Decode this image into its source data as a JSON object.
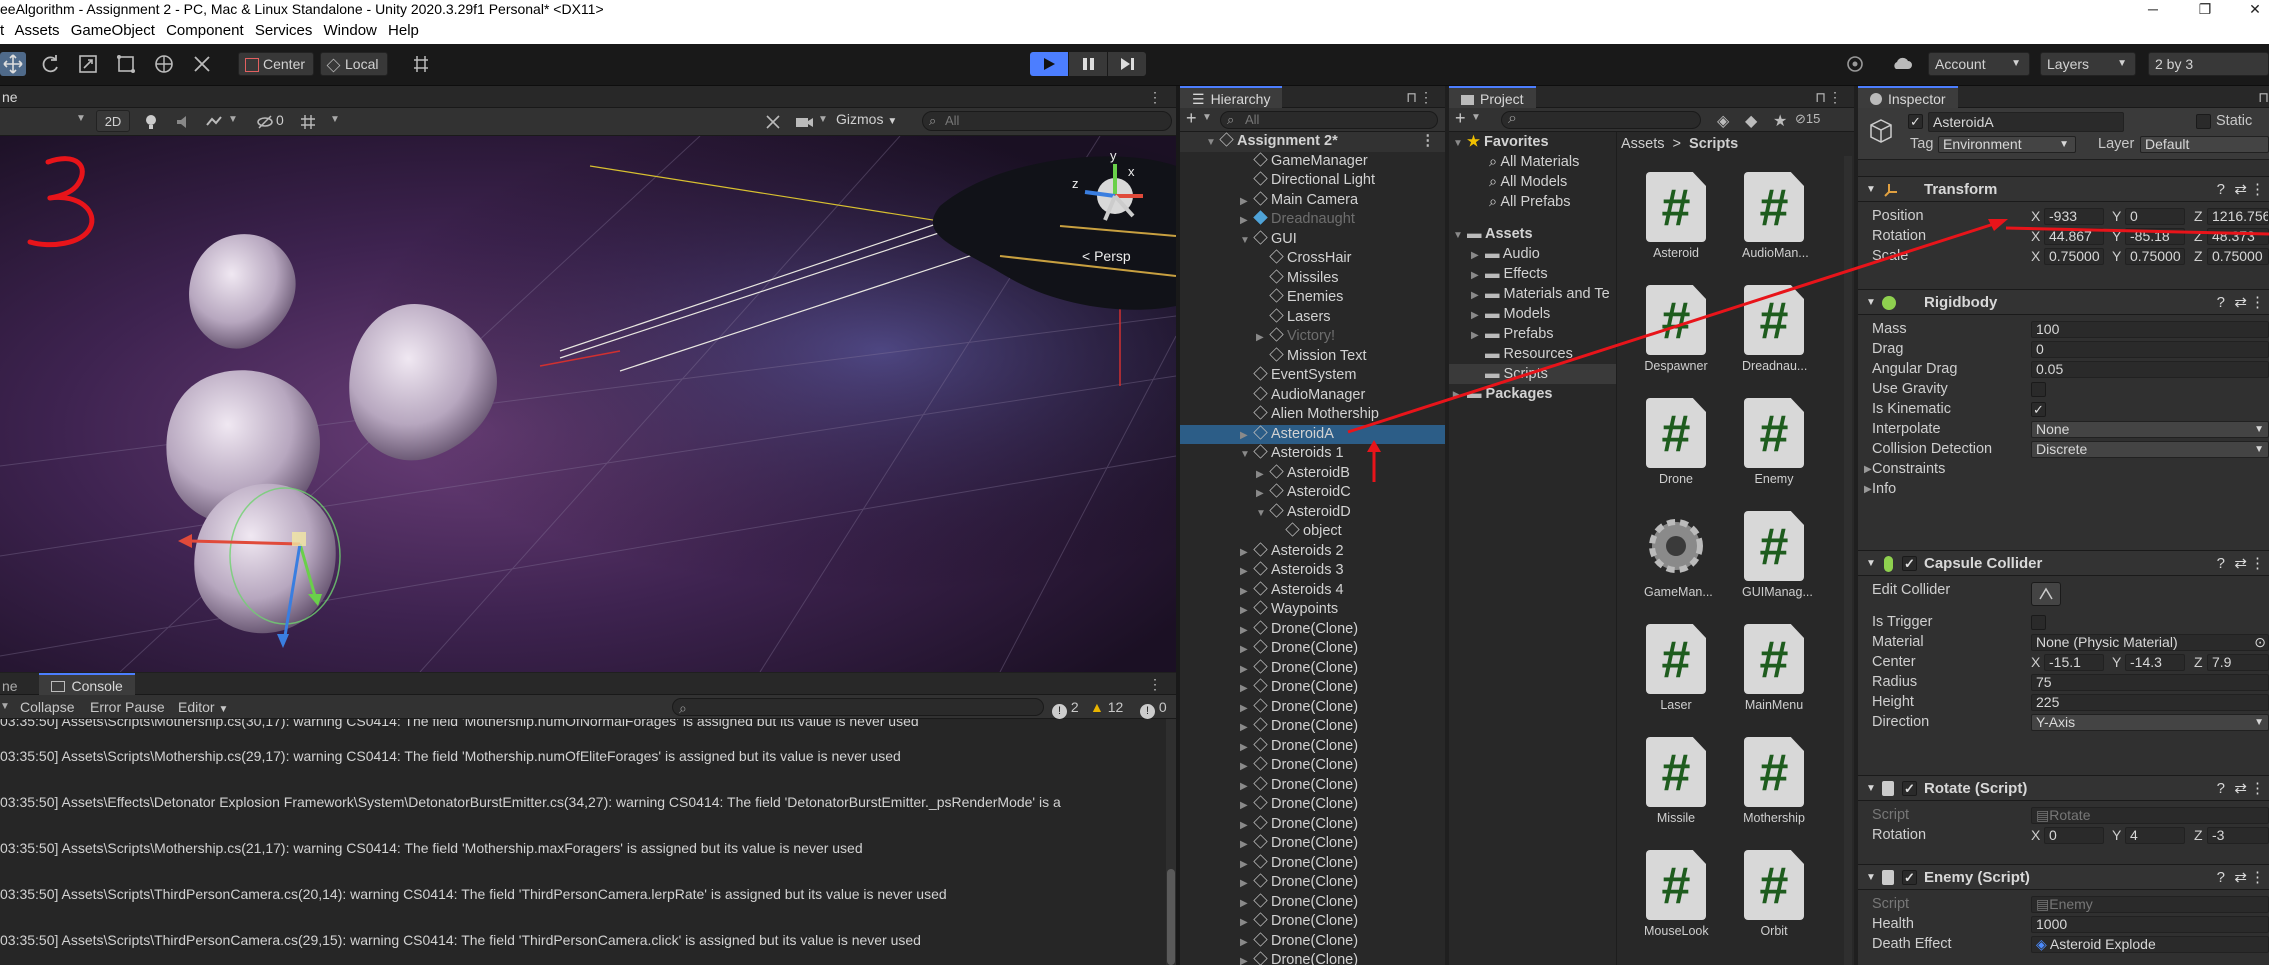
{
  "window": {
    "title": "eeAlgorithm - Assignment 2 - PC, Mac & Linux Standalone - Unity 2020.3.29f1 Personal* <DX11>",
    "controls": [
      "─",
      "❐",
      "✕"
    ]
  },
  "menu": [
    "t",
    "Assets",
    "GameObject",
    "Component",
    "Services",
    "Window",
    "Help"
  ],
  "toolbar": {
    "pivot": "Center",
    "space": "Local",
    "account": "Account",
    "layers": "Layers",
    "layout": "2 by 3"
  },
  "scene": {
    "tab": "ne",
    "mode_2d": "2D",
    "hidden_count": "0",
    "gizmos": "Gizmos",
    "search_placeholder": "All",
    "persp_label": "< Persp",
    "annotation": "3"
  },
  "console": {
    "tab_game": "ne",
    "tab": "Console",
    "clear_dropdown": "",
    "collapse": "Collapse",
    "error_pause": "Error Pause",
    "editor": "Editor",
    "count_info": "2",
    "count_warn": "12",
    "count_err": "0",
    "logs": [
      "03:35:50] Assets\\Scripts\\Mothership.cs(30,17): warning CS0414: The field 'Mothership.numOfNormalForages' is assigned but its value is never used",
      "03:35:50] Assets\\Scripts\\Mothership.cs(29,17): warning CS0414: The field 'Mothership.numOfEliteForages' is assigned but its value is never used",
      "03:35:50] Assets\\Effects\\Detonator Explosion Framework\\System\\DetonatorBurstEmitter.cs(34,27): warning CS0414: The field 'DetonatorBurstEmitter._psRenderMode' is a",
      "03:35:50] Assets\\Scripts\\Mothership.cs(21,17): warning CS0414: The field 'Mothership.maxForagers' is assigned but its value is never used",
      "03:35:50] Assets\\Scripts\\ThirdPersonCamera.cs(20,14): warning CS0414: The field 'ThirdPersonCamera.lerpRate' is assigned but its value is never used",
      "03:35:50] Assets\\Scripts\\ThirdPersonCamera.cs(29,15): warning CS0414: The field 'ThirdPersonCamera.click' is assigned but its value is never used"
    ]
  },
  "hierarchy": {
    "tab": "Hierarchy",
    "search_placeholder": "All",
    "items": [
      {
        "label": "Assignment 2*",
        "level": 0,
        "fold": "▼",
        "scene": true
      },
      {
        "label": "GameManager",
        "level": 1,
        "fold": ""
      },
      {
        "label": "Directional Light",
        "level": 1,
        "fold": ""
      },
      {
        "label": "Main Camera",
        "level": 1,
        "fold": "▶"
      },
      {
        "label": "Dreadnaught",
        "level": 1,
        "fold": "▶",
        "dim": true
      },
      {
        "label": "GUI",
        "level": 1,
        "fold": "▼"
      },
      {
        "label": "CrossHair",
        "level": 2,
        "fold": ""
      },
      {
        "label": "Missiles",
        "level": 2,
        "fold": ""
      },
      {
        "label": "Enemies",
        "level": 2,
        "fold": ""
      },
      {
        "label": "Lasers",
        "level": 2,
        "fold": ""
      },
      {
        "label": "Victory!",
        "level": 2,
        "fold": "▶",
        "dim": true
      },
      {
        "label": "Mission Text",
        "level": 2,
        "fold": ""
      },
      {
        "label": "EventSystem",
        "level": 1,
        "fold": ""
      },
      {
        "label": "AudioManager",
        "level": 1,
        "fold": ""
      },
      {
        "label": "Alien Mothership",
        "level": 1,
        "fold": ""
      },
      {
        "label": "AsteroidA",
        "level": 1,
        "fold": "▶",
        "selected": true
      },
      {
        "label": "Asteroids 1",
        "level": 1,
        "fold": "▼"
      },
      {
        "label": "AsteroidB",
        "level": 2,
        "fold": "▶"
      },
      {
        "label": "AsteroidC",
        "level": 2,
        "fold": "▶"
      },
      {
        "label": "AsteroidD",
        "level": 2,
        "fold": "▼"
      },
      {
        "label": "object",
        "level": 3,
        "fold": ""
      },
      {
        "label": "Asteroids 2",
        "level": 1,
        "fold": "▶"
      },
      {
        "label": "Asteroids 3",
        "level": 1,
        "fold": "▶"
      },
      {
        "label": "Asteroids 4",
        "level": 1,
        "fold": "▶"
      },
      {
        "label": "Waypoints",
        "level": 1,
        "fold": "▶"
      },
      {
        "label": "Drone(Clone)",
        "level": 1,
        "fold": "▶"
      },
      {
        "label": "Drone(Clone)",
        "level": 1,
        "fold": "▶"
      },
      {
        "label": "Drone(Clone)",
        "level": 1,
        "fold": "▶"
      },
      {
        "label": "Drone(Clone)",
        "level": 1,
        "fold": "▶"
      },
      {
        "label": "Drone(Clone)",
        "level": 1,
        "fold": "▶"
      },
      {
        "label": "Drone(Clone)",
        "level": 1,
        "fold": "▶"
      },
      {
        "label": "Drone(Clone)",
        "level": 1,
        "fold": "▶"
      },
      {
        "label": "Drone(Clone)",
        "level": 1,
        "fold": "▶"
      },
      {
        "label": "Drone(Clone)",
        "level": 1,
        "fold": "▶"
      },
      {
        "label": "Drone(Clone)",
        "level": 1,
        "fold": "▶"
      },
      {
        "label": "Drone(Clone)",
        "level": 1,
        "fold": "▶"
      },
      {
        "label": "Drone(Clone)",
        "level": 1,
        "fold": "▶"
      },
      {
        "label": "Drone(Clone)",
        "level": 1,
        "fold": "▶"
      },
      {
        "label": "Drone(Clone)",
        "level": 1,
        "fold": "▶"
      },
      {
        "label": "Drone(Clone)",
        "level": 1,
        "fold": "▶"
      },
      {
        "label": "Drone(Clone)",
        "level": 1,
        "fold": "▶"
      },
      {
        "label": "Drone(Clone)",
        "level": 1,
        "fold": "▶"
      },
      {
        "label": "Drone(Clone)",
        "level": 1,
        "fold": "▶"
      }
    ]
  },
  "project": {
    "tab": "Project",
    "hidden_count": "15",
    "breadcrumb": [
      "Assets",
      ">",
      "Scripts"
    ],
    "favorites_label": "Favorites",
    "favorites": [
      "All Materials",
      "All Models",
      "All Prefabs"
    ],
    "assets_label": "Assets",
    "folders": [
      "Audio",
      "Effects",
      "Materials and Te",
      "Models",
      "Prefabs",
      "Resources",
      "Scripts"
    ],
    "packages_label": "Packages",
    "files": [
      {
        "name": "Asteroid",
        "kind": "script"
      },
      {
        "name": "AudioMan...",
        "kind": "script"
      },
      {
        "name": "Despawner",
        "kind": "script"
      },
      {
        "name": "Dreadnau...",
        "kind": "script"
      },
      {
        "name": "Drone",
        "kind": "script"
      },
      {
        "name": "Enemy",
        "kind": "script"
      },
      {
        "name": "GameMan...",
        "kind": "gear"
      },
      {
        "name": "GUIManag...",
        "kind": "script"
      },
      {
        "name": "Laser",
        "kind": "script"
      },
      {
        "name": "MainMenu",
        "kind": "script"
      },
      {
        "name": "Missile",
        "kind": "script"
      },
      {
        "name": "Mothership",
        "kind": "script"
      },
      {
        "name": "MouseLook",
        "kind": "script"
      },
      {
        "name": "Orbit",
        "kind": "script"
      }
    ]
  },
  "inspector": {
    "tab": "Inspector",
    "object_name": "AsteroidA",
    "static_label": "Static",
    "tag_label": "Tag",
    "tag": "Environment",
    "layer_label": "Layer",
    "layer": "Default",
    "transform": {
      "title": "Transform",
      "position_label": "Position",
      "position": {
        "x": "-933",
        "y": "0",
        "z": "1216.756"
      },
      "rotation_label": "Rotation",
      "rotation": {
        "x": "44.867",
        "y": "-85.18",
        "z": "48.373"
      },
      "scale_label": "Scale",
      "scale": {
        "x": "0.75000",
        "y": "0.75000",
        "z": "0.75000"
      }
    },
    "rigidbody": {
      "title": "Rigidbody",
      "rows": [
        {
          "label": "Mass",
          "value": "100"
        },
        {
          "label": "Drag",
          "value": "0"
        },
        {
          "label": "Angular Drag",
          "value": "0.05"
        }
      ],
      "use_gravity_label": "Use Gravity",
      "is_kinematic_label": "Is Kinematic",
      "is_kinematic_check": "✓",
      "interpolate_label": "Interpolate",
      "interpolate": "None",
      "collision_label": "Collision Detection",
      "collision": "Discrete",
      "constraints": "Constraints",
      "info": "Info"
    },
    "capsule": {
      "title": "Capsule Collider",
      "edit_collider": "Edit Collider",
      "is_trigger": "Is Trigger",
      "material_label": "Material",
      "material": "None (Physic Material)",
      "center_label": "Center",
      "center": {
        "x": "-15.1",
        "y": "-14.3",
        "z": "7.9"
      },
      "radius_label": "Radius",
      "radius": "75",
      "height_label": "Height",
      "height": "225",
      "direction_label": "Direction",
      "direction": "Y-Axis"
    },
    "rotate": {
      "title": "Rotate (Script)",
      "script_label": "Script",
      "script": "Rotate",
      "rotation_label": "Rotation",
      "rotation": {
        "x": "0",
        "y": "4",
        "z": "-3"
      }
    },
    "enemy": {
      "title": "Enemy (Script)",
      "script_label": "Script",
      "script": "Enemy",
      "health_label": "Health",
      "health": "1000",
      "death_label": "Death Effect",
      "death": "Asteroid Explode"
    }
  },
  "colors": {
    "accent": "#4c7eff",
    "selection": "#2c5d87",
    "annotation": "#e8141a",
    "play": "#4c7eff"
  }
}
